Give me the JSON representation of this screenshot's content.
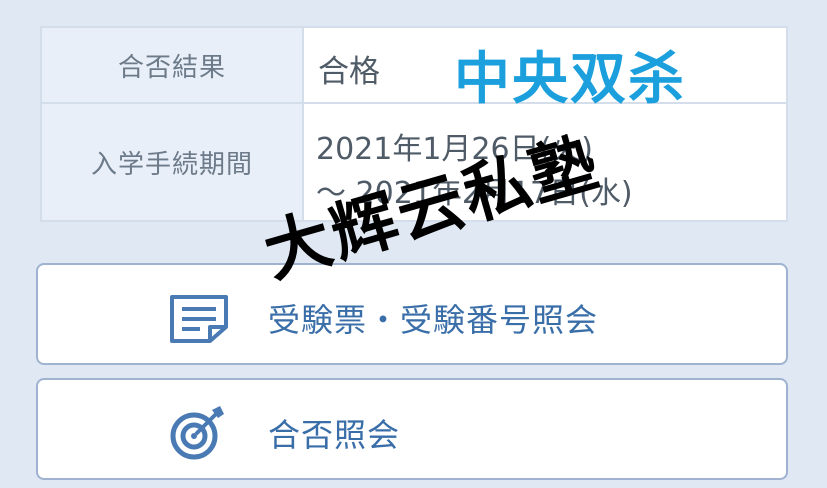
{
  "result_table": {
    "rows": [
      {
        "label": "合否結果",
        "value": "合格"
      },
      {
        "label": "入学手続期間",
        "value_lines": [
          "2021年1月26日(火)",
          "〜 2021年2月17日(水)"
        ]
      }
    ]
  },
  "overlay_text": "中央双杀",
  "buttons": [
    {
      "label": "受験票・受験番号照会",
      "icon": "document-icon"
    },
    {
      "label": "合否照会",
      "icon": "target-icon"
    }
  ],
  "watermark": "大辉云私塾",
  "colors": {
    "page_bg": "#dfe8f3",
    "label_bg": "#e8eff8",
    "button_text": "#3a6ea8",
    "icon": "#4a7ab3",
    "overlay_blue": "#1ba0dd"
  }
}
